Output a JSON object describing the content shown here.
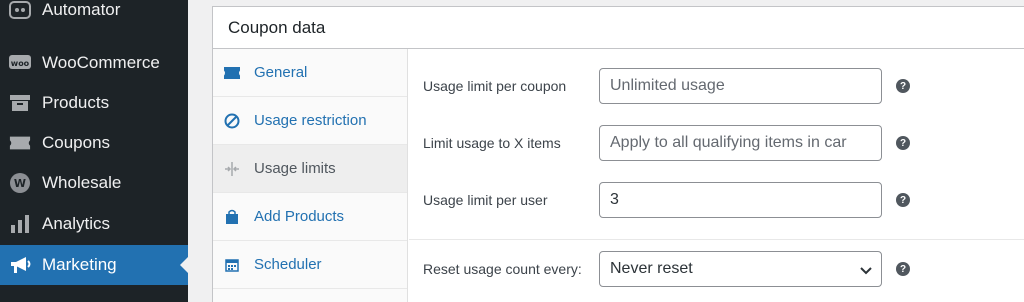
{
  "sidebar": {
    "items": [
      {
        "label": "Automator",
        "icon": "automator-icon"
      },
      {
        "label": "WooCommerce",
        "icon": "woocommerce-icon"
      },
      {
        "label": "Products",
        "icon": "products-icon"
      },
      {
        "label": "Coupons",
        "icon": "coupon-icon"
      },
      {
        "label": "Wholesale",
        "icon": "wholesale-icon"
      },
      {
        "label": "Analytics",
        "icon": "analytics-icon"
      },
      {
        "label": "Marketing",
        "icon": "megaphone-icon",
        "current": true
      }
    ]
  },
  "panel": {
    "title": "Coupon data",
    "tabs": [
      {
        "label": "General",
        "icon": "ticket-icon"
      },
      {
        "label": "Usage restriction",
        "icon": "restriction-icon"
      },
      {
        "label": "Usage limits",
        "icon": "limits-icon",
        "active": true
      },
      {
        "label": "Add Products",
        "icon": "bag-icon"
      },
      {
        "label": "Scheduler",
        "icon": "calendar-icon"
      }
    ],
    "fields": {
      "usage_limit_per_coupon": {
        "label": "Usage limit per coupon",
        "value": "",
        "placeholder": "Unlimited usage"
      },
      "limit_usage_to_x_items": {
        "label": "Limit usage to X items",
        "value": "",
        "placeholder": "Apply to all qualifying items in car"
      },
      "usage_limit_per_user": {
        "label": "Usage limit per user",
        "value": "3"
      },
      "reset_usage_count": {
        "label": "Reset usage count every:",
        "selected": "Never reset"
      }
    },
    "help_glyph": "?"
  },
  "colors": {
    "sidebar_bg": "#1d2327",
    "accent": "#2271b1",
    "link": "#2271b1"
  }
}
